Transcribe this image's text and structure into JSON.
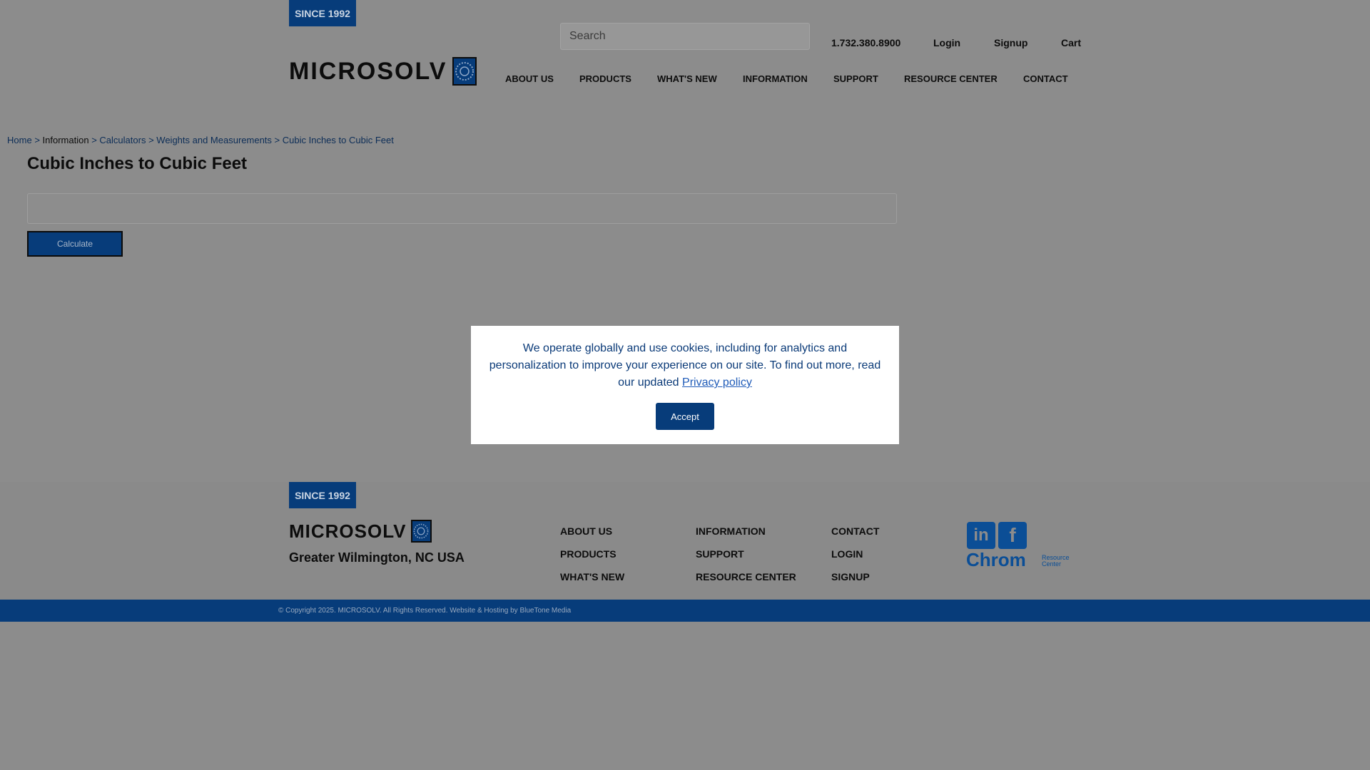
{
  "header": {
    "since_badge": "SINCE 1992",
    "logo_text": "MICROSOLV",
    "search_placeholder": "Search",
    "phone": "1.732.380.8900",
    "login": "Login",
    "signup": "Signup",
    "cart": "Cart",
    "nav": [
      "ABOUT US",
      "PRODUCTS",
      "WHAT'S NEW",
      "INFORMATION",
      "SUPPORT",
      "RESOURCE CENTER",
      "CONTACT"
    ]
  },
  "breadcrumb": {
    "home": "Home",
    "information": "Information",
    "calculators": "Calculators",
    "weights": "Weights and Measurements",
    "current": "Cubic Inches to Cubic Feet",
    "separator": ">"
  },
  "main": {
    "title": "Cubic Inches to Cubic Feet",
    "input_value": "",
    "calculate_label": "Calculate"
  },
  "cookie": {
    "message": "We operate globally and use cookies, including for analytics and personalization to improve your experience on our site. To find out more, read our updated",
    "policy_link": "Privacy policy",
    "accept_label": "Accept"
  },
  "footer": {
    "since_badge": "SINCE 1992",
    "logo_text": "MICROSOLV",
    "location": "Greater Wilmington, NC USA",
    "col1": [
      "ABOUT US",
      "PRODUCTS",
      "WHAT'S NEW"
    ],
    "col2": [
      "INFORMATION",
      "SUPPORT",
      "RESOURCE CENTER"
    ],
    "col3": [
      "CONTACT",
      "LOGIN",
      "SIGNUP"
    ],
    "social": {
      "linkedin_icon": "linkedin-icon",
      "facebook_icon": "facebook-icon",
      "linkedin_glyph": "in",
      "facebook_glyph": "f"
    },
    "chrom_logo": "Chrom",
    "chrom_sub_line1": "Resource",
    "chrom_sub_line2": "Center",
    "copyright": "© Copyright 2025. MICROSOLV. All Rights Reserved. Website & Hosting by BlueTone Media"
  },
  "colors": {
    "brand_blue": "#073c7a",
    "overlay_gray": "#8c8c8c",
    "link_blue": "#0c2d57"
  }
}
